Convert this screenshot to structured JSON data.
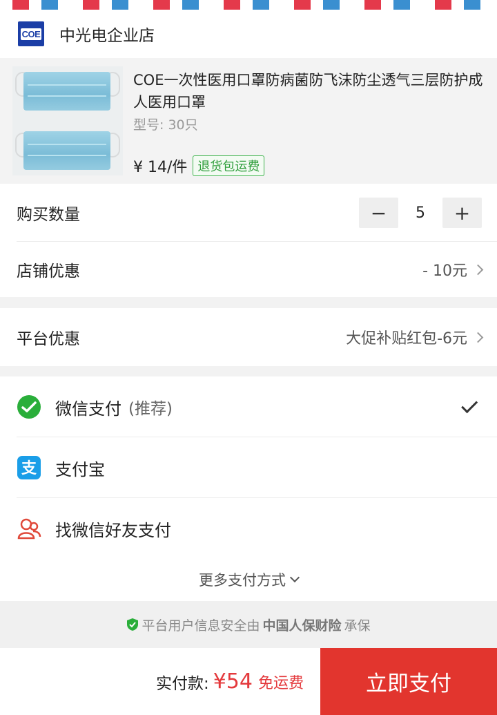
{
  "shop": {
    "logo_text": "COE",
    "name": "中光电企业店"
  },
  "product": {
    "title": "COE一次性医用口罩防病菌防飞沫防尘透气三层防护成人医用口罩",
    "spec": "型号: 30只",
    "price": "¥ 14/件",
    "tag": "退货包运费"
  },
  "quantity": {
    "label": "购买数量",
    "minus": "−",
    "value": "5",
    "plus": "+"
  },
  "store_discount": {
    "label": "店铺优惠",
    "value": "- 10元"
  },
  "platform_discount": {
    "label": "平台优惠",
    "value": "大促补贴红包-6元"
  },
  "payment": {
    "methods": [
      {
        "label": "微信支付",
        "hint": "(推荐)",
        "icon": "wechat-pay-icon",
        "selected": true
      },
      {
        "label": "支付宝",
        "hint": "",
        "icon": "alipay-icon",
        "selected": false
      },
      {
        "label": "找微信好友支付",
        "hint": "",
        "icon": "friends-icon",
        "selected": false
      }
    ],
    "more": "更多支付方式"
  },
  "security": {
    "prefix": "平台用户信息安全由",
    "brand": "中国人保财险",
    "suffix": "承保"
  },
  "footer": {
    "total_label": "实付款:",
    "total_amount": "¥54",
    "shipping": "免运费",
    "pay_button": "立即支付"
  },
  "colors": {
    "accent": "#e2352e",
    "tag_green": "#3cb34a",
    "wechat_green": "#2aae3a",
    "alipay_blue": "#1a9ee8"
  }
}
